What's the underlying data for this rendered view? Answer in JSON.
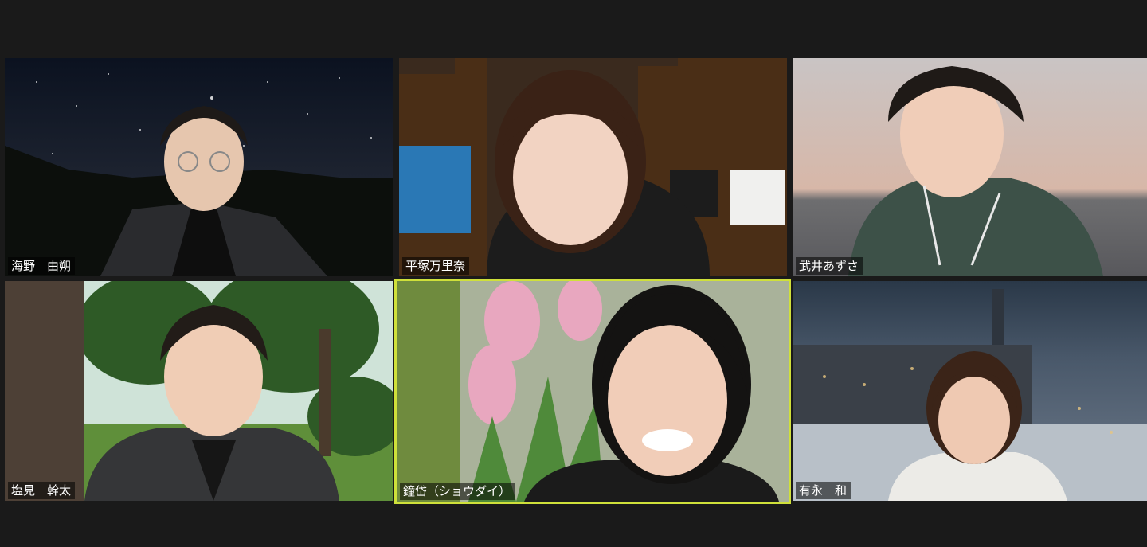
{
  "participants": [
    {
      "name": "海野　由朔"
    },
    {
      "name": "平塚万里奈"
    },
    {
      "name": "武井あずさ"
    },
    {
      "name": "塩見　幹太"
    },
    {
      "name": "鐘岱（ショウダイ）"
    },
    {
      "name": "有永　和"
    }
  ],
  "active_speaker_color": "#cfe03a",
  "background_color": "#1a1a1a"
}
